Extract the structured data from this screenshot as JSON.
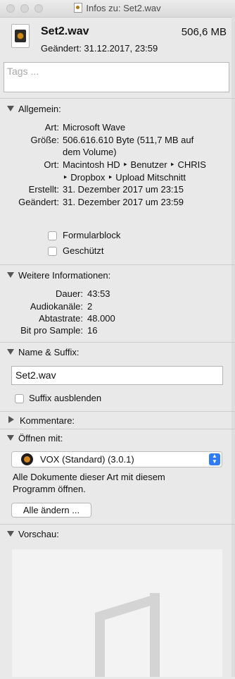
{
  "window": {
    "title": "Infos zu: Set2.wav"
  },
  "file": {
    "name": "Set2.wav",
    "size": "506,6 MB",
    "modified": "Geändert: 31.12.2017, 23:59"
  },
  "tags": {
    "placeholder": "Tags ..."
  },
  "general": {
    "title": "Allgemein:",
    "rows": [
      {
        "label": "Art:",
        "value": "Microsoft Wave"
      },
      {
        "label": "Größe:",
        "value": "506.616.610 Byte (511,7 MB auf",
        "value2": "dem Volume)"
      },
      {
        "label": "Ort:",
        "value": "Macintosh HD ‣ Benutzer ‣ CHRIS",
        "value2": "‣ Dropbox ‣ Upload Mitschnitt"
      },
      {
        "label": "Erstellt:",
        "value": "31. Dezember 2017 um 23:15"
      },
      {
        "label": "Geändert:",
        "value": "31. Dezember 2017 um 23:59"
      }
    ],
    "checkbox_stationery": "Formularblock",
    "checkbox_locked": "Geschützt"
  },
  "more_info": {
    "title": "Weitere Informationen:",
    "rows": [
      {
        "label": "Dauer:",
        "value": "43:53"
      },
      {
        "label": "Audiokanäle:",
        "value": "2"
      },
      {
        "label": "Abtastrate:",
        "value": "48.000"
      },
      {
        "label": "Bit pro Sample:",
        "value": "16"
      }
    ]
  },
  "name_ext": {
    "title": "Name & Suffix:",
    "value": "Set2.wav",
    "hide_ext": "Suffix ausblenden"
  },
  "comments": {
    "title": "Kommentare:"
  },
  "open_with": {
    "title": "Öffnen mit:",
    "app": "VOX (Standard) (3.0.1)",
    "note_line1": "Alle Dokumente dieser Art mit diesem",
    "note_line2": "Programm öffnen.",
    "change_all": "Alle ändern ..."
  },
  "preview": {
    "title": "Vorschau:"
  }
}
